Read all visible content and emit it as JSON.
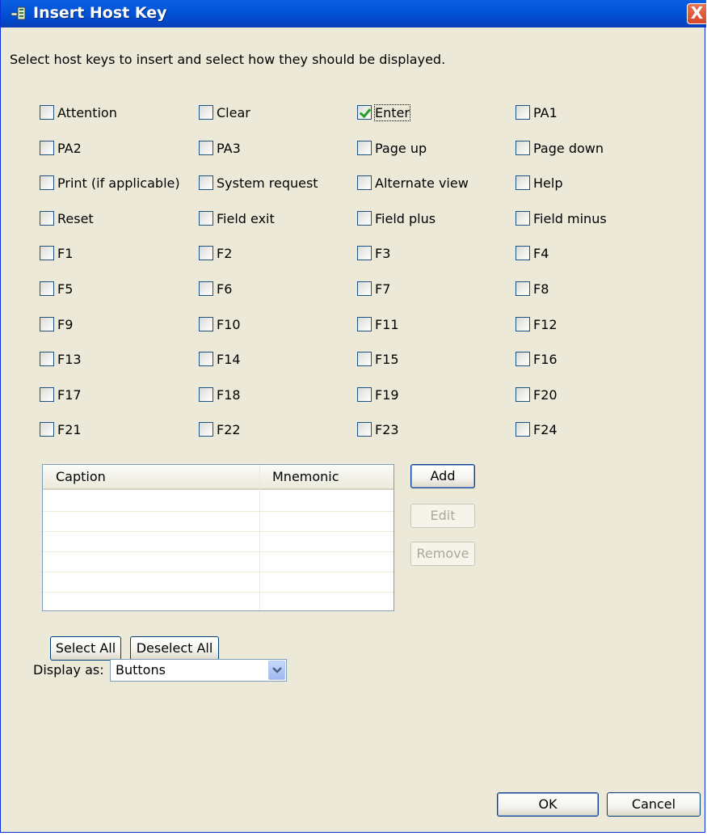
{
  "window": {
    "title": "Insert Host Key",
    "close_label": "X"
  },
  "instructions": "Select host keys to insert and select how they should be displayed.",
  "keys": [
    {
      "label": "Attention",
      "checked": false
    },
    {
      "label": "Clear",
      "checked": false
    },
    {
      "label": "Enter",
      "checked": true
    },
    {
      "label": "PA1",
      "checked": false
    },
    {
      "label": "PA2",
      "checked": false
    },
    {
      "label": "PA3",
      "checked": false
    },
    {
      "label": "Page up",
      "checked": false
    },
    {
      "label": "Page down",
      "checked": false
    },
    {
      "label": "Print (if applicable)",
      "checked": false
    },
    {
      "label": "System request",
      "checked": false
    },
    {
      "label": "Alternate view",
      "checked": false
    },
    {
      "label": "Help",
      "checked": false
    },
    {
      "label": "Reset",
      "checked": false
    },
    {
      "label": "Field exit",
      "checked": false
    },
    {
      "label": "Field plus",
      "checked": false
    },
    {
      "label": "Field minus",
      "checked": false
    },
    {
      "label": "F1",
      "checked": false
    },
    {
      "label": "F2",
      "checked": false
    },
    {
      "label": "F3",
      "checked": false
    },
    {
      "label": "F4",
      "checked": false
    },
    {
      "label": "F5",
      "checked": false
    },
    {
      "label": "F6",
      "checked": false
    },
    {
      "label": "F7",
      "checked": false
    },
    {
      "label": "F8",
      "checked": false
    },
    {
      "label": "F9",
      "checked": false
    },
    {
      "label": "F10",
      "checked": false
    },
    {
      "label": "F11",
      "checked": false
    },
    {
      "label": "F12",
      "checked": false
    },
    {
      "label": "F13",
      "checked": false
    },
    {
      "label": "F14",
      "checked": false
    },
    {
      "label": "F15",
      "checked": false
    },
    {
      "label": "F16",
      "checked": false
    },
    {
      "label": "F17",
      "checked": false
    },
    {
      "label": "F18",
      "checked": false
    },
    {
      "label": "F19",
      "checked": false
    },
    {
      "label": "F20",
      "checked": false
    },
    {
      "label": "F21",
      "checked": false
    },
    {
      "label": "F22",
      "checked": false
    },
    {
      "label": "F23",
      "checked": false
    },
    {
      "label": "F24",
      "checked": false
    }
  ],
  "custom_keys_table": {
    "columns": [
      "Caption",
      "Mnemonic"
    ],
    "rows": []
  },
  "buttons": {
    "add": "Add",
    "edit": "Edit",
    "remove": "Remove",
    "select_all": "Select All",
    "deselect_all": "Deselect All",
    "ok": "OK",
    "cancel": "Cancel"
  },
  "display_as": {
    "label": "Display as:",
    "value": "Buttons"
  },
  "colors": {
    "titlebar": "#0353d8",
    "dialog_bg": "#ece9d8",
    "check": "#21a121",
    "close": "#d6482a"
  },
  "icons": {
    "window_icon": "keyboard-icon",
    "close_icon": "close-icon",
    "dropdown": "chevron-down-icon"
  }
}
